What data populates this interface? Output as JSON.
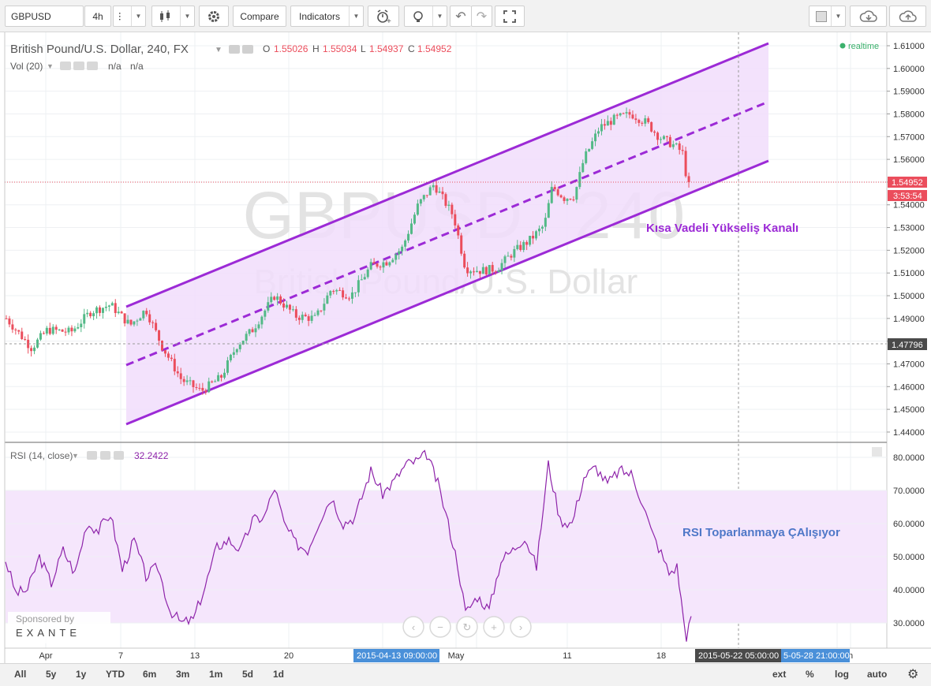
{
  "toolbar": {
    "symbol": "GBPUSD",
    "interval": "4h",
    "compare_label": "Compare",
    "indicators_label": "Indicators"
  },
  "legend": {
    "title": "British Pound/U.S. Dollar, 240, FX",
    "open_label": "O",
    "open_value": "1.55026",
    "high_label": "H",
    "high_value": "1.55034",
    "low_label": "L",
    "low_value": "1.54937",
    "close_label": "C",
    "close_value": "1.54952",
    "vol_label": "Vol (20)",
    "vol_value_1": "n/a",
    "vol_value_2": "n/a",
    "realtime": "realtime"
  },
  "watermark": {
    "symbol": "GBPUSD",
    "interval": "240",
    "description": "British Pound/U.S. Dollar"
  },
  "annotations": {
    "channel_label": "Kısa Vadeli Yükseliş Kanalı",
    "rsi_label": "RSI Toparlanmaya ÇAlışıyor"
  },
  "price_axis": {
    "ticks": [
      "1.61000",
      "1.60000",
      "1.59000",
      "1.58000",
      "1.57000",
      "1.56000",
      "1.55000",
      "1.54000",
      "1.53000",
      "1.52000",
      "1.51000",
      "1.50000",
      "1.49000",
      "1.48000",
      "1.47000",
      "1.46000",
      "1.45000",
      "1.44000"
    ],
    "last_price": "1.54952",
    "countdown": "3:53:54",
    "crosshair_price": "1.47796"
  },
  "rsi": {
    "label": "RSI (14, close)",
    "value": "32.2422",
    "ticks": [
      "80.0000",
      "70.0000",
      "60.0000",
      "50.0000",
      "40.0000",
      "30.0000"
    ]
  },
  "time_axis": {
    "ticks": [
      "Apr",
      "7",
      "13",
      "20",
      "May",
      "11",
      "18",
      "n"
    ],
    "crosshair_time": "2015-04-13 09:00:00",
    "range_start": "2015-05-22 05:00:00",
    "range_end": "5-05-28 21:00:00"
  },
  "sponsor": {
    "label": "Sponsored by",
    "brand": "EXANTE"
  },
  "bottom": {
    "ranges": [
      "All",
      "5y",
      "1y",
      "YTD",
      "6m",
      "3m",
      "1m",
      "5d",
      "1d"
    ],
    "right": [
      "ext",
      "%",
      "log",
      "auto"
    ]
  },
  "colors": {
    "up": "#53b987",
    "down": "#eb4d5c",
    "channel": "#9c2ad6",
    "rsi_line": "#8e24aa",
    "channel_fill": "#f1ddfb",
    "rsi_band": "#f5e6fc",
    "label_blue": "#4f78c8"
  },
  "chart_data": [
    {
      "type": "candlestick",
      "title": "British Pound/U.S. Dollar, 240, FX",
      "x_ticks": [
        "Apr",
        "7",
        "13",
        "20",
        "May",
        "11",
        "18"
      ],
      "ylim": [
        1.44,
        1.61
      ],
      "points": [
        {
          "x": "Apr",
          "y": 1.488
        },
        {
          "x": "7",
          "y": 1.49
        },
        {
          "x": "13",
          "y": 1.463
        },
        {
          "x": "20",
          "y": 1.496
        },
        {
          "x": "May",
          "y": 1.513
        },
        {
          "x": "11",
          "y": 1.553
        },
        {
          "x": "18",
          "y": 1.566
        }
      ],
      "last": {
        "open": 1.55026,
        "high": 1.55034,
        "low": 1.54937,
        "close": 1.54952
      },
      "channel": {
        "name": "Kısa Vadeli Yükseliş Kanalı",
        "upper": [
          1.493,
          1.61
        ],
        "middle": [
          1.468,
          1.585
        ],
        "lower": [
          1.443,
          1.56
        ]
      }
    },
    {
      "type": "line",
      "title": "RSI (14, close)",
      "ylim": [
        25,
        83
      ],
      "band": [
        30,
        70
      ],
      "last": 32.2422
    }
  ]
}
